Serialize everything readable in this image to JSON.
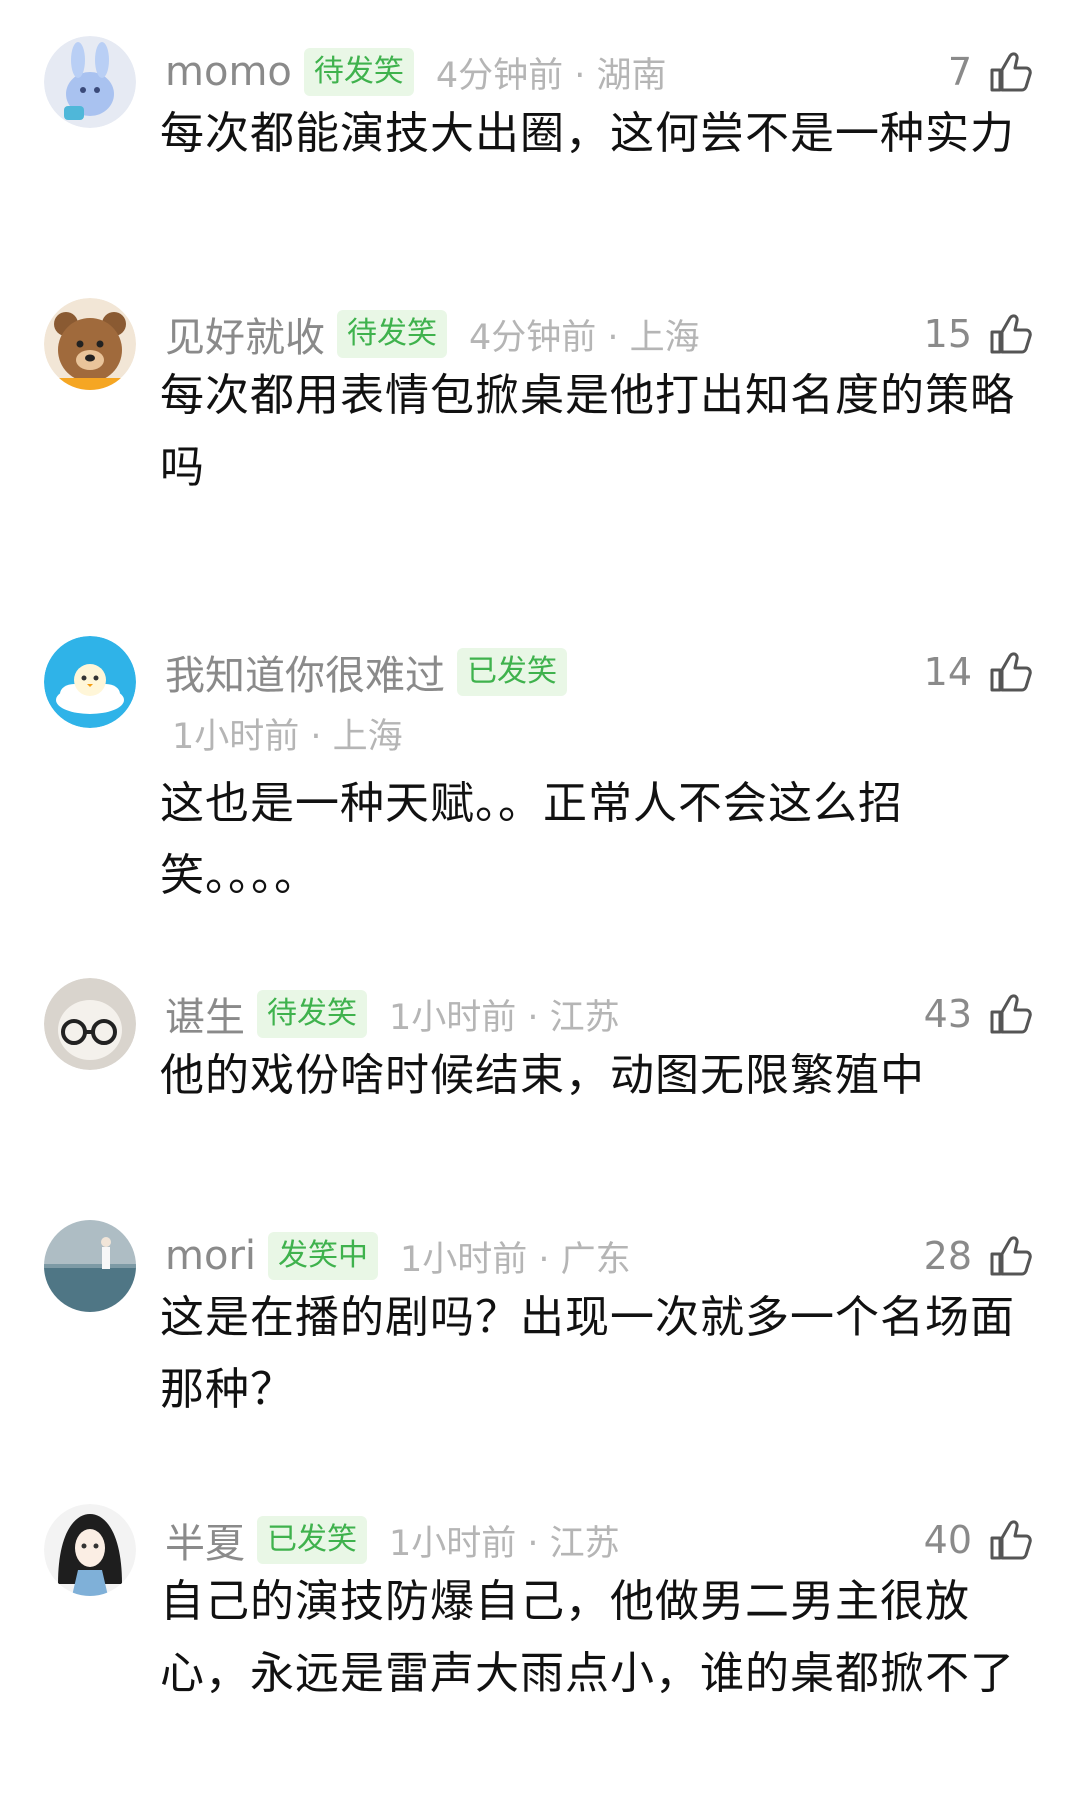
{
  "comments": [
    {
      "name": "momo",
      "badge": "待发笑",
      "time_location": "4分钟前 · 湖南",
      "likes": "7",
      "text": "每次都能演技大出圈，这何尝不是一种实力",
      "avatar_icon": "blue-rabbit-plush-avatar"
    },
    {
      "name": "见好就收",
      "badge": "待发笑",
      "time_location": "4分钟前 · 上海",
      "likes": "15",
      "text": "每次都用表情包掀桌是他打出知名度的策略吗",
      "avatar_icon": "brown-bear-avatar"
    },
    {
      "name": "我知道你很难过",
      "badge": "已发笑",
      "time_location": "1小时前 · 上海",
      "likes": "14",
      "text": "这也是一种天赋。。正常人不会这么招笑。。。。",
      "avatar_icon": "chick-on-cloud-avatar"
    },
    {
      "name": "谌生",
      "badge": "待发笑",
      "time_location": "1小时前 · 江苏",
      "likes": "43",
      "text": "他的戏份啥时候结束，动图无限繁殖中",
      "avatar_icon": "plush-with-glasses-avatar"
    },
    {
      "name": "mori",
      "badge": "发笑中",
      "time_location": "1小时前 · 广东",
      "likes": "28",
      "text": "这是在播的剧吗？出现一次就多一个名场面那种？",
      "avatar_icon": "seaside-person-avatar"
    },
    {
      "name": "半夏",
      "badge": "已发笑",
      "time_location": "1小时前 · 江苏",
      "likes": "40",
      "text": "自己的演技防爆自己，他做男二男主很放心，永远是雷声大雨点小，谁的桌都掀不了",
      "avatar_icon": "anime-girl-avatar"
    }
  ],
  "colors": {
    "badge_bg": "#e9f7e6",
    "badge_text": "#3fb24d",
    "meta_text": "#b5b5b5",
    "name_text": "#8a8a8a"
  },
  "like_icon": "thumbs-up-icon"
}
